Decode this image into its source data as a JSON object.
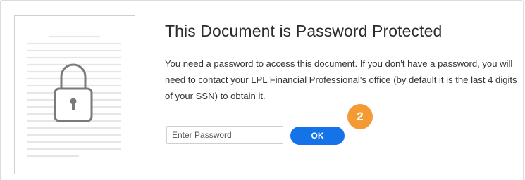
{
  "dialog": {
    "title": "This Document is Password Protected",
    "message": "You need a password to access this document. If you don't have a password, you will need to contact your LPL Financial Professional's office (by default it is the last 4 digits of your SSN) to obtain it."
  },
  "form": {
    "password_placeholder": "Enter Password",
    "password_value": "",
    "ok_label": "OK"
  },
  "annotation": {
    "step_number": "2",
    "badge_color": "#f39a35"
  },
  "colors": {
    "primary_button": "#1473e6"
  },
  "icons": {
    "thumbnail": "document-lock-icon"
  }
}
